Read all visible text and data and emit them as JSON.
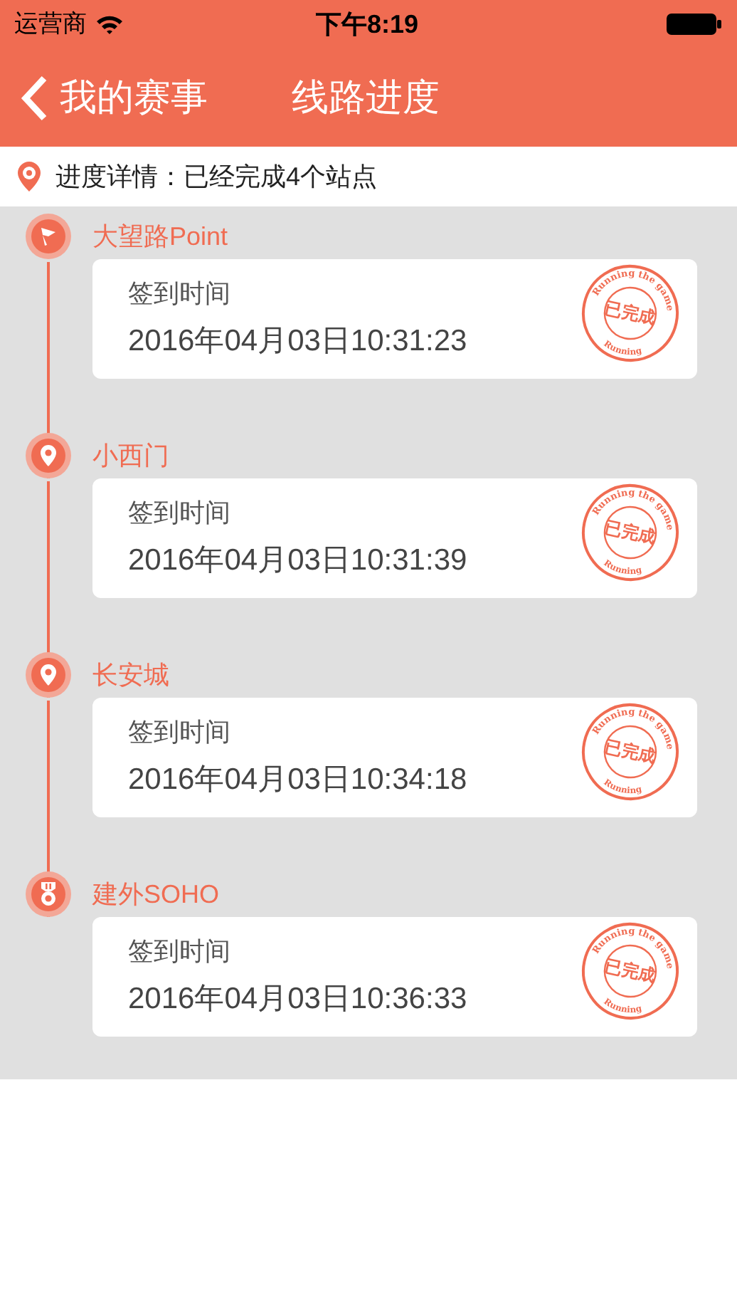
{
  "status_bar": {
    "carrier": "运营商",
    "time": "下午8:19"
  },
  "nav_bar": {
    "back_label": "我的赛事",
    "title": "线路进度"
  },
  "summary": {
    "text": "进度详情：已经完成4个站点"
  },
  "checkpoints": [
    {
      "kind": "start",
      "name": "大望路Point",
      "label": "签到时间",
      "time": "2016年04月03日10:31:23",
      "stamp": {
        "top": "Running the game",
        "center": "已完成",
        "bottom": "Running"
      }
    },
    {
      "kind": "checkpoint",
      "name": "小西门",
      "label": "签到时间",
      "time": "2016年04月03日10:31:39",
      "stamp": {
        "top": "Running the game",
        "center": "已完成",
        "bottom": "Running"
      }
    },
    {
      "kind": "checkpoint",
      "name": "长安城",
      "label": "签到时间",
      "time": "2016年04月03日10:34:18",
      "stamp": {
        "top": "Running the game",
        "center": "已完成",
        "bottom": "Running"
      }
    },
    {
      "kind": "finish",
      "name": "建外SOHO",
      "label": "签到时间",
      "time": "2016年04月03日10:36:33",
      "stamp": {
        "top": "Running the game",
        "center": "已完成",
        "bottom": "Running"
      }
    }
  ]
}
